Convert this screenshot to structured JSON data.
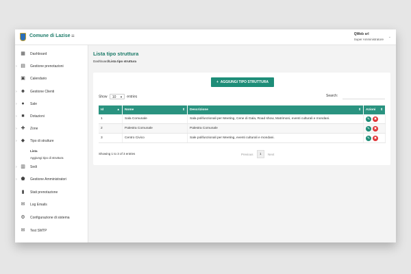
{
  "brand": "Comune di Lazise",
  "user": {
    "name": "QWeb srl",
    "role": "Super Amministratore"
  },
  "sidebar": {
    "items": [
      {
        "label": "Dashboard",
        "icon": "dashboard-icon",
        "glyph": "▦",
        "expand": false
      },
      {
        "label": "Gestione prenotazioni",
        "icon": "list-icon",
        "glyph": "▤",
        "expand": true
      },
      {
        "label": "Calendario",
        "icon": "calendar-icon",
        "glyph": "▣",
        "expand": false
      },
      {
        "label": "Gestione Clienti",
        "icon": "users-icon",
        "glyph": "☻",
        "expand": true
      },
      {
        "label": "Sale",
        "icon": "pin-icon",
        "glyph": "●",
        "expand": true
      },
      {
        "label": "Dotazioni",
        "icon": "box-icon",
        "glyph": "■",
        "expand": true
      },
      {
        "label": "Zone",
        "icon": "puzzle-icon",
        "glyph": "✚",
        "expand": true
      },
      {
        "label": "Tipo di strutture",
        "icon": "tag-icon",
        "glyph": "◆",
        "expand": true
      },
      {
        "label": "Sedi",
        "icon": "building-icon",
        "glyph": "▥",
        "expand": true
      },
      {
        "label": "Gestione Amministratori",
        "icon": "shield-icon",
        "glyph": "⬟",
        "expand": true
      },
      {
        "label": "Stati prenotazione",
        "icon": "status-icon",
        "glyph": "▮",
        "expand": false
      },
      {
        "label": "Log Emails",
        "icon": "mail-icon",
        "glyph": "✉",
        "expand": false
      },
      {
        "label": "Configurazione di sistema",
        "icon": "gear-icon",
        "glyph": "⚙",
        "expand": false
      },
      {
        "label": "Test SMTP",
        "icon": "envelope-icon",
        "glyph": "✉",
        "expand": false
      }
    ],
    "submenu": [
      "Lista",
      "Aggiungi tipo di struttura"
    ]
  },
  "page": {
    "title": "Lista tipo struttura",
    "crumb_root": "Dashboard",
    "crumb_current": "/Lista tipo struttura"
  },
  "add_button": "AGGIUNGI TIPO STRUTTURA",
  "show": {
    "label": "Show",
    "value": "10",
    "suffix": "entries"
  },
  "search_label": "Search:",
  "table": {
    "headers": [
      "Id",
      "Nome",
      "Descrizione",
      "Azioni"
    ],
    "rows": [
      {
        "id": "1",
        "nome": "Sala Comunale",
        "desc": "Sala polifunzionali per Meeting, Cene di Gala, Road show, Matrimoni, eventi culturali e mondani."
      },
      {
        "id": "2",
        "nome": "Palestra Comunale",
        "desc": "Palestra Comunale"
      },
      {
        "id": "3",
        "nome": "Centro Civico",
        "desc": "Sale polifunzionali per Meeting, eventi culturali e mondani."
      }
    ]
  },
  "showing": "Showing 1 to 3 of 3 entries",
  "pager": {
    "prev": "Previous",
    "page": "1",
    "next": "Next"
  },
  "colors": {
    "accent": "#1e8d78",
    "header": "#2a9380",
    "danger": "#e0373a"
  }
}
